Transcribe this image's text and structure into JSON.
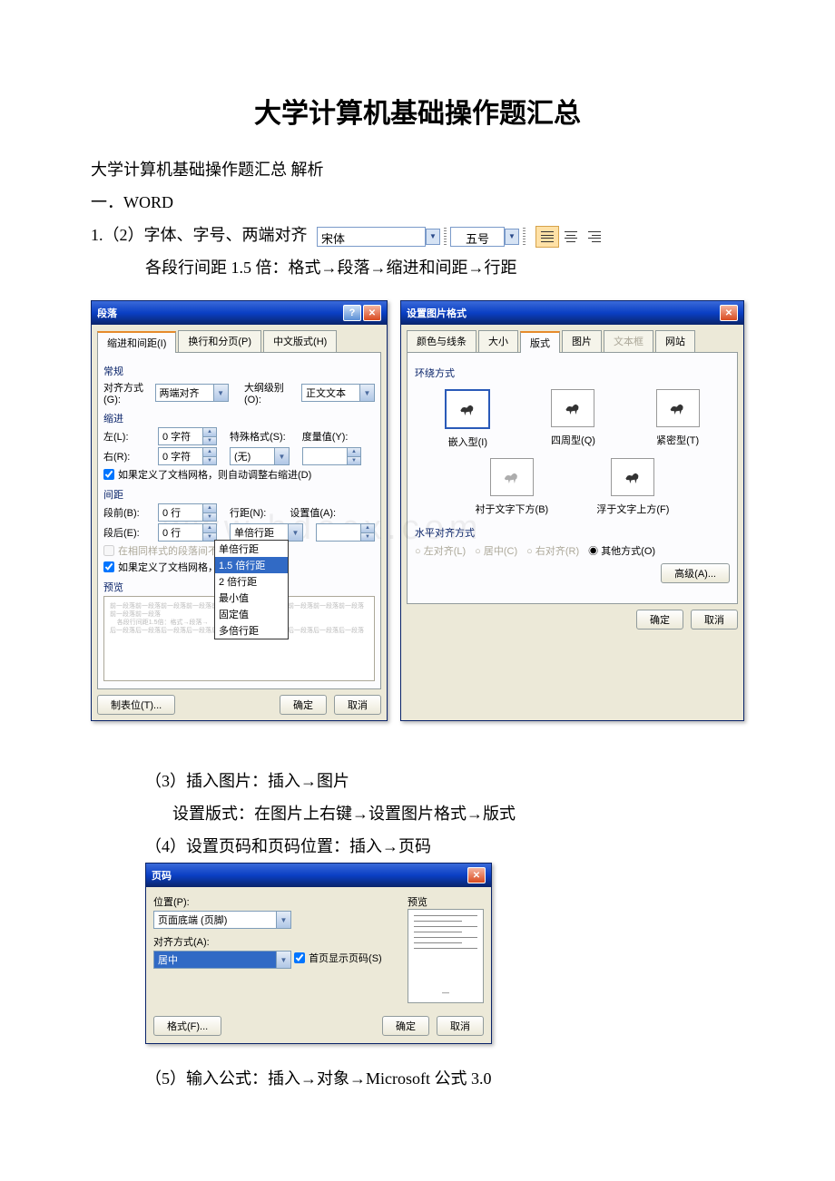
{
  "title": "大学计算机基础操作题汇总",
  "p1": "大学计算机基础操作题汇总 解析",
  "p2": "一．WORD",
  "p3_prefix": "1.（2）字体、字号、两端对齐",
  "toolbar": {
    "font": "宋体",
    "size": "五号"
  },
  "p4": "各段行间距 1.5 倍：格式→段落→缩进和间距→行距",
  "dlg_para": {
    "title": "段落",
    "tabs": [
      "缩进和间距(I)",
      "换行和分页(P)",
      "中文版式(H)"
    ],
    "group_general": "常规",
    "align_label": "对齐方式(G):",
    "align_val": "两端对齐",
    "outline_label": "大纲级别(O):",
    "outline_val": "正文文本",
    "group_indent": "缩进",
    "left_label": "左(L):",
    "left_val": "0 字符",
    "right_label": "右(R):",
    "right_val": "0 字符",
    "special_label": "特殊格式(S):",
    "special_val": "(无)",
    "by_label": "度量值(Y):",
    "chk1": "如果定义了文档网格，则自动调整右缩进(D)",
    "group_space": "间距",
    "before_label": "段前(B):",
    "before_val": "0 行",
    "after_label": "段后(E):",
    "after_val": "0 行",
    "ls_label": "行距(N):",
    "ls_val": "单倍行距",
    "setat_label": "设置值(A):",
    "chk2_dis": "在相同样式的段落间不添加空",
    "chk3": "如果定义了文档网格，则对齐",
    "options": [
      "单倍行距",
      "1.5 倍行距",
      "2 倍行距",
      "最小值",
      "固定值",
      "多倍行距"
    ],
    "preview_label": "预览",
    "tabstops": "制表位(T)...",
    "ok": "确定",
    "cancel": "取消"
  },
  "dlg_pic": {
    "title": "设置图片格式",
    "tabs": [
      "颜色与线条",
      "大小",
      "版式",
      "图片",
      "文本框",
      "网站"
    ],
    "group_wrap": "环绕方式",
    "wrap": [
      "嵌入型(I)",
      "四周型(Q)",
      "紧密型(T)",
      "衬于文字下方(B)",
      "浮于文字上方(F)"
    ],
    "group_align": "水平对齐方式",
    "radios": [
      "左对齐(L)",
      "居中(C)",
      "右对齐(R)",
      "其他方式(O)"
    ],
    "advanced": "高级(A)...",
    "ok": "确定",
    "cancel": "取消"
  },
  "p5": "（3）插入图片：插入→图片",
  "p6": "设置版式：在图片上右键→设置图片格式→版式",
  "p7": "（4）设置页码和页码位置：插入→页码",
  "dlg_pn": {
    "title": "页码",
    "pos_label": "位置(P):",
    "pos_val": "页面底端 (页脚)",
    "align_label": "对齐方式(A):",
    "align_val": "居中",
    "chk": "首页显示页码(S)",
    "preview": "预览",
    "format": "格式(F)...",
    "ok": "确定",
    "cancel": "取消"
  },
  "p8": "（5）输入公式：插入→对象→Microsoft 公式 3.0",
  "watermark": "www.bdocx.com"
}
